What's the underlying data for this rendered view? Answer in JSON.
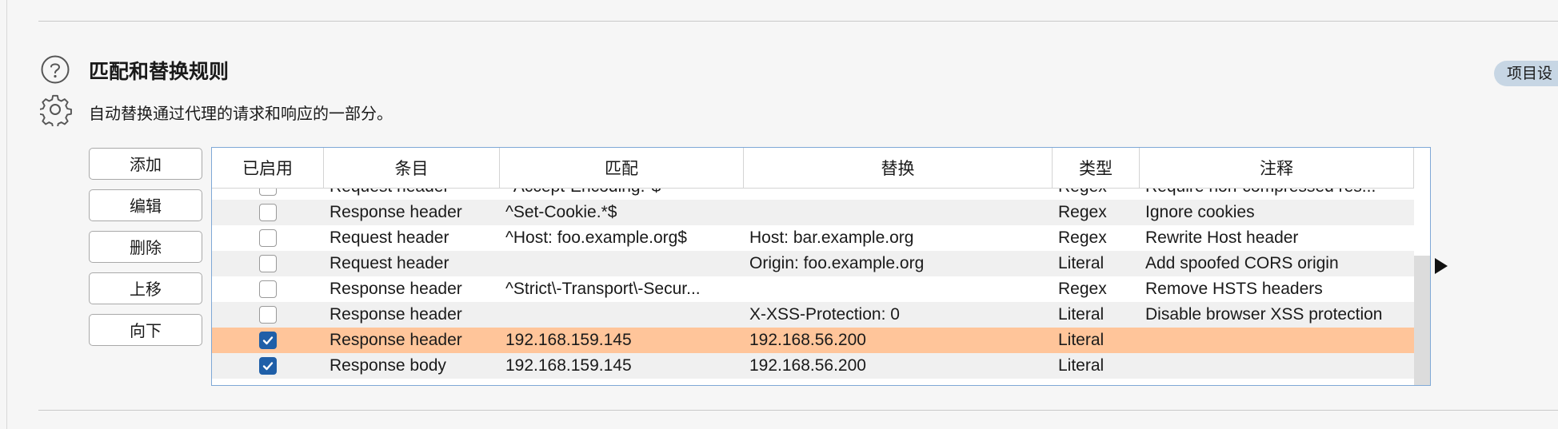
{
  "header": {
    "title": "匹配和替换规则",
    "description": "自动替换通过代理的请求和响应的一部分。",
    "project_settings_label": "项目设"
  },
  "icons": {
    "help": "help-circle-icon",
    "settings": "gear-icon",
    "scroll": "triangle-right-icon"
  },
  "buttons": {
    "add": "添加",
    "edit": "编辑",
    "delete": "删除",
    "move_up": "上移",
    "move_down": "向下"
  },
  "table": {
    "columns": {
      "enabled": "已启用",
      "item": "条目",
      "match": "匹配",
      "replace": "替换",
      "type": "类型",
      "comment": "注释"
    },
    "rows": [
      {
        "enabled": false,
        "item": "Request header",
        "match": "^Accept-Encoding.*$",
        "replace": "",
        "type": "Regex",
        "comment": "Require non-compressed res..."
      },
      {
        "enabled": false,
        "item": "Response header",
        "match": "^Set-Cookie.*$",
        "replace": "",
        "type": "Regex",
        "comment": "Ignore cookies"
      },
      {
        "enabled": false,
        "item": "Request header",
        "match": "^Host: foo.example.org$",
        "replace": "Host: bar.example.org",
        "type": "Regex",
        "comment": "Rewrite Host header"
      },
      {
        "enabled": false,
        "item": "Request header",
        "match": "",
        "replace": "Origin: foo.example.org",
        "type": "Literal",
        "comment": "Add spoofed CORS origin"
      },
      {
        "enabled": false,
        "item": "Response header",
        "match": "^Strict\\-Transport\\-Secur...",
        "replace": "",
        "type": "Regex",
        "comment": "Remove HSTS headers"
      },
      {
        "enabled": false,
        "item": "Response header",
        "match": "",
        "replace": "X-XSS-Protection: 0",
        "type": "Literal",
        "comment": "Disable browser XSS protection"
      },
      {
        "enabled": true,
        "item": "Response header",
        "match": "192.168.159.145",
        "replace": "192.168.56.200",
        "type": "Literal",
        "comment": "",
        "selected": true
      },
      {
        "enabled": true,
        "item": "Response body",
        "match": "192.168.159.145",
        "replace": "192.168.56.200",
        "type": "Literal",
        "comment": ""
      }
    ]
  },
  "colors": {
    "selected_row": "#ffc59a",
    "checkbox_checked": "#1f5fa8",
    "table_border": "#7fa8d6",
    "pill_bg": "#c7d6e4"
  }
}
